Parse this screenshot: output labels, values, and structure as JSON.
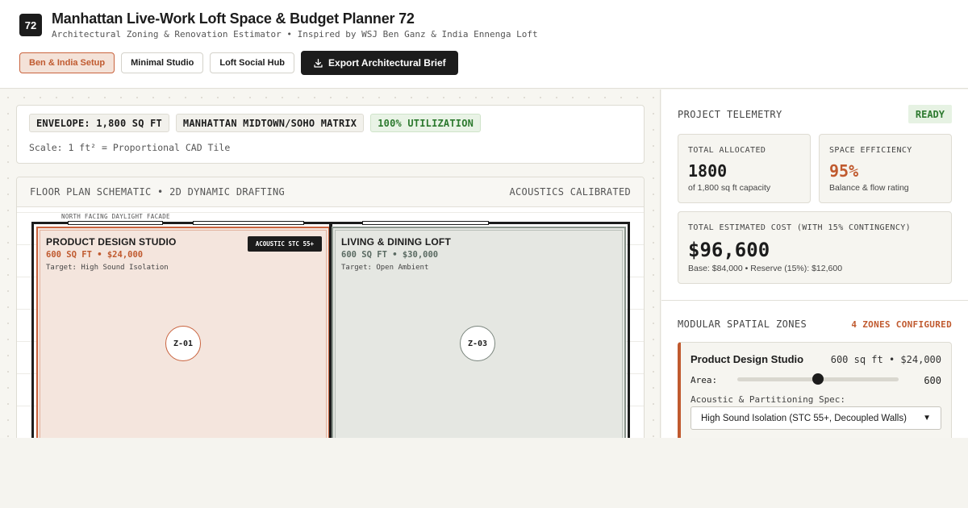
{
  "header": {
    "logo": "72",
    "title": "Manhattan Live-Work Loft Space & Budget Planner 72",
    "subtitle": "Architectural Zoning & Renovation Estimator • Inspired by WSJ Ben Ganz & India Ennenga Loft",
    "presets": [
      {
        "label": "Ben & India Setup",
        "active": true
      },
      {
        "label": "Minimal Studio",
        "active": false
      },
      {
        "label": "Loft Social Hub",
        "active": false
      }
    ],
    "export_label": "Export Architectural Brief"
  },
  "envelope": {
    "chips": [
      "ENVELOPE: 1,800 SQ FT",
      "MANHATTAN MIDTOWN/SOHO MATRIX",
      "100% UTILIZATION"
    ],
    "scale": "Scale: 1 ft² = Proportional CAD Tile"
  },
  "plan": {
    "title": "FLOOR PLAN SCHEMATIC • 2D DYNAMIC DRAFTING",
    "status": "ACOUSTICS CALIBRATED",
    "facade_label": "NORTH FACING DAYLIGHT FACADE",
    "zones": [
      {
        "name": "PRODUCT DESIGN STUDIO",
        "meta": "600 SQ FT • $24,000",
        "target": "Target: High Sound Isolation",
        "badge": "ACOUSTIC STC 55+",
        "id": "Z-01"
      },
      {
        "name": "LIVING & DINING LOFT",
        "meta": "600 SQ FT • $30,000",
        "target": "Target: Open Ambient",
        "id": "Z-03"
      }
    ]
  },
  "telemetry": {
    "heading": "PROJECT TELEMETRY",
    "status": "READY",
    "total_allocated": {
      "label": "TOTAL ALLOCATED",
      "value": "1800",
      "sub": "of 1,800 sq ft capacity"
    },
    "efficiency": {
      "label": "SPACE EFFICIENCY",
      "value": "95%",
      "sub": "Balance & flow rating"
    },
    "cost": {
      "label": "TOTAL ESTIMATED COST (WITH 15% CONTINGENCY)",
      "value": "$96,600",
      "sub": "Base: $84,000 • Reserve (15%): $12,600"
    }
  },
  "zones_panel": {
    "heading": "MODULAR SPATIAL ZONES",
    "count": "4 ZONES CONFIGURED",
    "zone": {
      "name": "Product Design Studio",
      "meta": "600 sq ft • $24,000",
      "area_label": "Area:",
      "area_value": "600",
      "area_fraction": 0.5,
      "spec_label": "Acoustic & Partitioning Spec:",
      "spec_value": "High Sound Isolation (STC 55+, Decoupled Walls)"
    }
  },
  "icons": {
    "export": "download-icon",
    "select": "chevron-down-icon"
  },
  "colors": {
    "accent": "#c05a2f",
    "dark": "#1c1c1c",
    "success": "#2d7a2f"
  }
}
